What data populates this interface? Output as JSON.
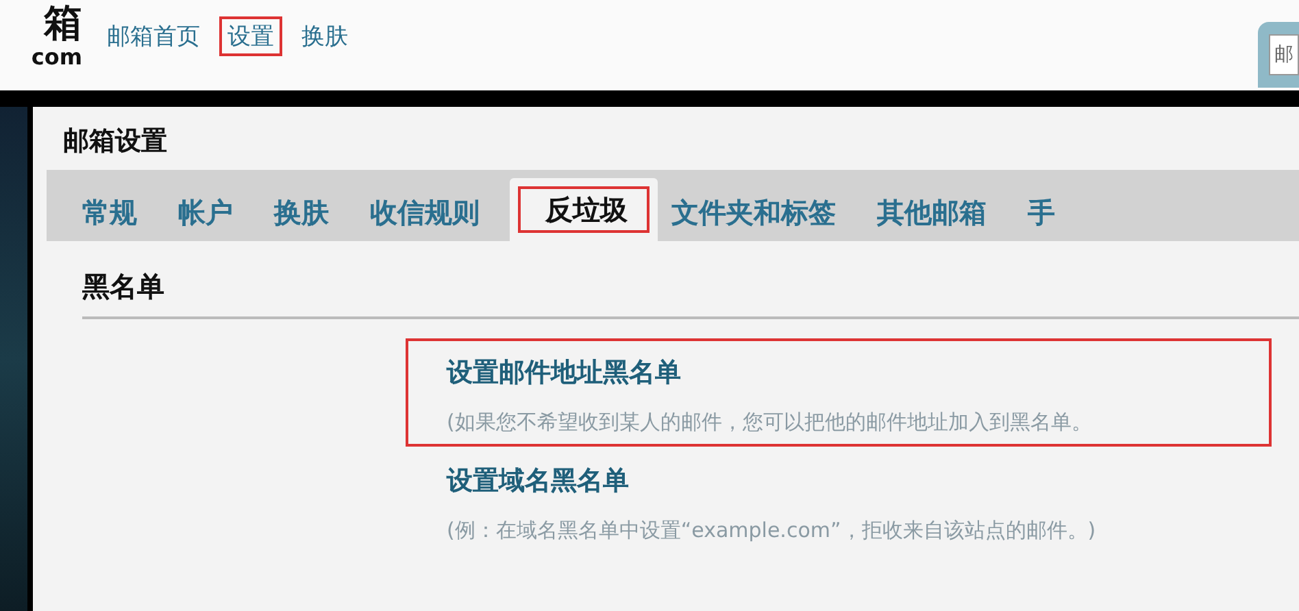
{
  "header": {
    "logo": {
      "top": "箱",
      "bottom": "com"
    },
    "nav": [
      {
        "label": "邮箱首页",
        "annotated": false
      },
      {
        "label": "设置",
        "annotated": true
      },
      {
        "label": "换肤",
        "annotated": false
      }
    ],
    "corner_button": "邮"
  },
  "dialog": {
    "title": "邮箱设置",
    "tabs": [
      {
        "label": "常规",
        "selected": false,
        "annotated": false
      },
      {
        "label": "帐户",
        "selected": false,
        "annotated": false
      },
      {
        "label": "换肤",
        "selected": false,
        "annotated": false
      },
      {
        "label": "收信规则",
        "selected": false,
        "annotated": false
      },
      {
        "label": "反垃圾",
        "selected": true,
        "annotated": true
      },
      {
        "label": "文件夹和标签",
        "selected": false,
        "annotated": false
      },
      {
        "label": "其他邮箱",
        "selected": false,
        "annotated": false
      },
      {
        "label": "手",
        "selected": false,
        "annotated": false
      }
    ],
    "section": "黑名单",
    "items": [
      {
        "title": "设置邮件地址黑名单",
        "description": "(如果您不希望收到某人的邮件，您可以把他的邮件地址加入到黑名单。",
        "annotated": true
      },
      {
        "title": "设置域名黑名单",
        "description": "(例：在域名黑名单中设置“example.com”，拒收来自该站点的邮件。)",
        "annotated": false
      }
    ]
  }
}
